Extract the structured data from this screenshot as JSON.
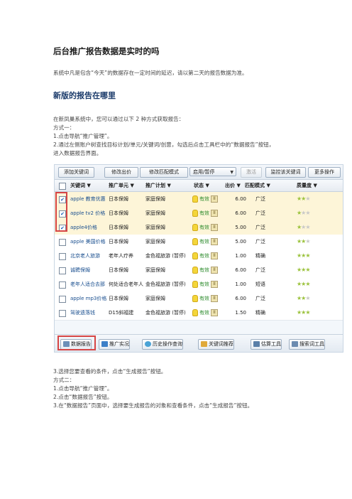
{
  "doc": {
    "title": "后台推广报告数据是实时的吗",
    "intro": "系统中凡是包含“今天”的数据存在一定时间的延迟，请以第二天的报告数据为准。",
    "section_title": "新版的报告在哪里",
    "p1": "在新凤巢系统中，您可以通过以下 2 种方式获取报告：",
    "m1": "方式一：",
    "s1": "1.点击导航“推广管理”。",
    "s2a": "2.通过左侧账户树查找目标计划/单元/关键词/创意，勾选后点击工具栏中的“数据报告”按钮，",
    "s2b": "进入数据报告界面。",
    "s3": "3.选择您要查看的条件，点击“生成报告”按钮。",
    "m2": "方式二：",
    "t1": "1.点击导航“推广管理”。",
    "t2": "2.点击“数据报告”按钮。",
    "t3": "3.在“数据报告”页面中，选择要生成报告的对象和查看条件，点击“生成报告”按钮。"
  },
  "toolbar": {
    "add_keyword": "添加关键词",
    "edit_bid": "修改出价",
    "edit_match": "修改匹配模式",
    "enable_pause": "启用/暂停",
    "activate": "激活",
    "monitor": "监控该关键词",
    "more": "更多操作"
  },
  "columns": {
    "keyword": "关键词",
    "unit": "推广单元",
    "plan": "推广计划",
    "status": "状态",
    "bid": "出价",
    "match": "匹配模式",
    "quality": "质量度"
  },
  "rows": [
    {
      "keyword": "apple 教育优惠",
      "unit": "日本保姆",
      "plan": "家庭保姆",
      "status": "有效",
      "bid": "6.00",
      "match": "广泛",
      "quality": 2,
      "checked": true
    },
    {
      "keyword": "apple tv2 价格",
      "unit": "日本保姆",
      "plan": "家庭保姆",
      "status": "有效",
      "bid": "6.00",
      "match": "广泛",
      "quality": 1,
      "checked": true
    },
    {
      "keyword": "apple4价格",
      "unit": "日本保姆",
      "plan": "家庭保姆",
      "status": "有效",
      "bid": "5.00",
      "match": "广泛",
      "quality": 1,
      "checked": true
    },
    {
      "keyword": "apple 美国价格",
      "unit": "日本保姆",
      "plan": "家庭保姆",
      "status": "有效",
      "bid": "5.00",
      "match": "广泛",
      "quality": 2,
      "checked": false
    },
    {
      "keyword": "北京老人旅游",
      "unit": "老年人疗养",
      "plan": "金色福旅游 (暂停)",
      "status": "有效",
      "bid": "1.00",
      "match": "精确",
      "quality": 3,
      "checked": false
    },
    {
      "keyword": "诚聘保姆",
      "unit": "日本保姆",
      "plan": "家庭保姆",
      "status": "有效",
      "bid": "6.00",
      "match": "广泛",
      "quality": 3,
      "checked": false
    },
    {
      "keyword": "老年人适合去那",
      "unit": "何处适合老年人",
      "plan": "金色福旅游 (暂停)",
      "status": "有效",
      "bid": "1.00",
      "match": "短语",
      "quality": 3,
      "checked": false
    },
    {
      "keyword": "apple mp3价格",
      "unit": "日本保姆",
      "plan": "家庭保姆",
      "status": "有效",
      "bid": "6.00",
      "match": "广泛",
      "quality": 2,
      "checked": false
    },
    {
      "keyword": "驾驶遗落钱",
      "unit": "D15斜福建",
      "plan": "金色福旅游 (暂停)",
      "status": "有效",
      "bid": "1.50",
      "match": "精确",
      "quality": 3,
      "checked": false
    }
  ],
  "bottom_bar": {
    "report": "数据报告",
    "realtime": "推广实况",
    "history": "历史操作查询",
    "recommend": "关键词推荐",
    "estimate": "估算工具",
    "search_tool": "搜索词工具"
  },
  "colors": {
    "highlight": "#d64545",
    "selected_row": "#fdf5d8",
    "valid": "#2a8a2a"
  }
}
